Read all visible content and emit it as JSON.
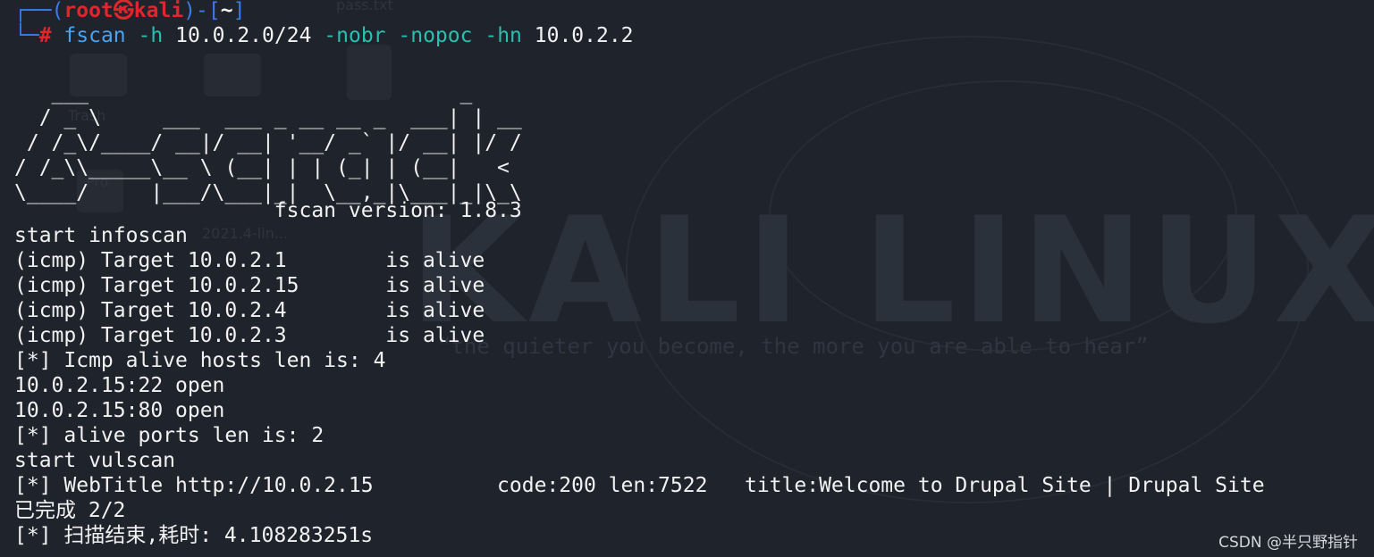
{
  "prompt": {
    "user": "root",
    "separator": "㉿",
    "host": "kali",
    "dir": "~",
    "hash": "#"
  },
  "command": {
    "program": "fscan",
    "flag_h": "-h",
    "target": "10.0.2.0/24",
    "flag_nobr": "-nobr",
    "flag_nopoc": "-nopoc",
    "flag_hn": "-hn",
    "exclude": "10.0.2.2"
  },
  "banner": {
    "art": "   ___                              _\n  / _ \\     ___  ___ _ __ __ _  ___| | __\n / /_\\/____/ __|/ __| '__/ _` |/ __| |/ /\n/ /_\\\\_____\\__ \\ (__| | | (_| | (__|   <\n\\____/     |___/\\___|_|  \\__,_|\\___|_|\\_\\",
    "version": "                     fscan version: 1.8.3"
  },
  "output": [
    "start infoscan",
    "(icmp) Target 10.0.2.1        is alive",
    "(icmp) Target 10.0.2.15       is alive",
    "(icmp) Target 10.0.2.4        is alive",
    "(icmp) Target 10.0.2.3        is alive",
    "[*] Icmp alive hosts len is: 4",
    "10.0.2.15:22 open",
    "10.0.2.15:80 open",
    "[*] alive ports len is: 2",
    "start vulscan",
    "[*] WebTitle http://10.0.2.15          code:200 len:7522   title:Welcome to Drupal Site | Drupal Site",
    "已完成 2/2",
    "[*] 扫描结束,耗时: 4.108283251s"
  ],
  "wallpaper": {
    "title": "KALI LINUX",
    "quote": "“the quieter you become, the more you are able to hear”",
    "desktop_labels": [
      "Trash",
      "Pro",
      "pass.txt",
      "2021.4-lin..."
    ]
  },
  "watermark": "CSDN @半只野指针",
  "colors": {
    "background": "#1f232b",
    "prompt_frame": "#3b7be8",
    "prompt_user": "#e0262c",
    "command": "#4aa3f0",
    "flag": "#28c0b0",
    "text": "#f2f2f2"
  }
}
